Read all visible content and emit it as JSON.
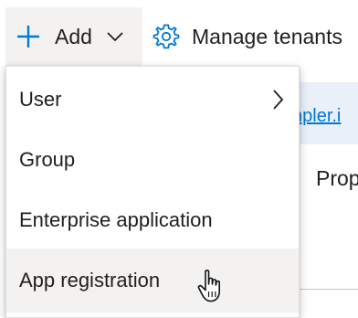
{
  "commandbar": {
    "add_label": "Add",
    "manage_label": "Manage tenants"
  },
  "background": {
    "link_text": "npler.i",
    "prop_text": "Prop"
  },
  "menu": {
    "items": [
      {
        "label": "User"
      },
      {
        "label": "Group"
      },
      {
        "label": "Enterprise application"
      },
      {
        "label": "App registration"
      }
    ]
  },
  "icons": {
    "add": "plus-icon",
    "add_caret": "chevron-down-icon",
    "manage": "gear-icon",
    "submenu": "chevron-right-icon",
    "pointer": "hand-cursor-icon"
  },
  "colors": {
    "accent": "#0078d4",
    "hover_bg": "#f3f2f1",
    "text": "#201f1e"
  }
}
